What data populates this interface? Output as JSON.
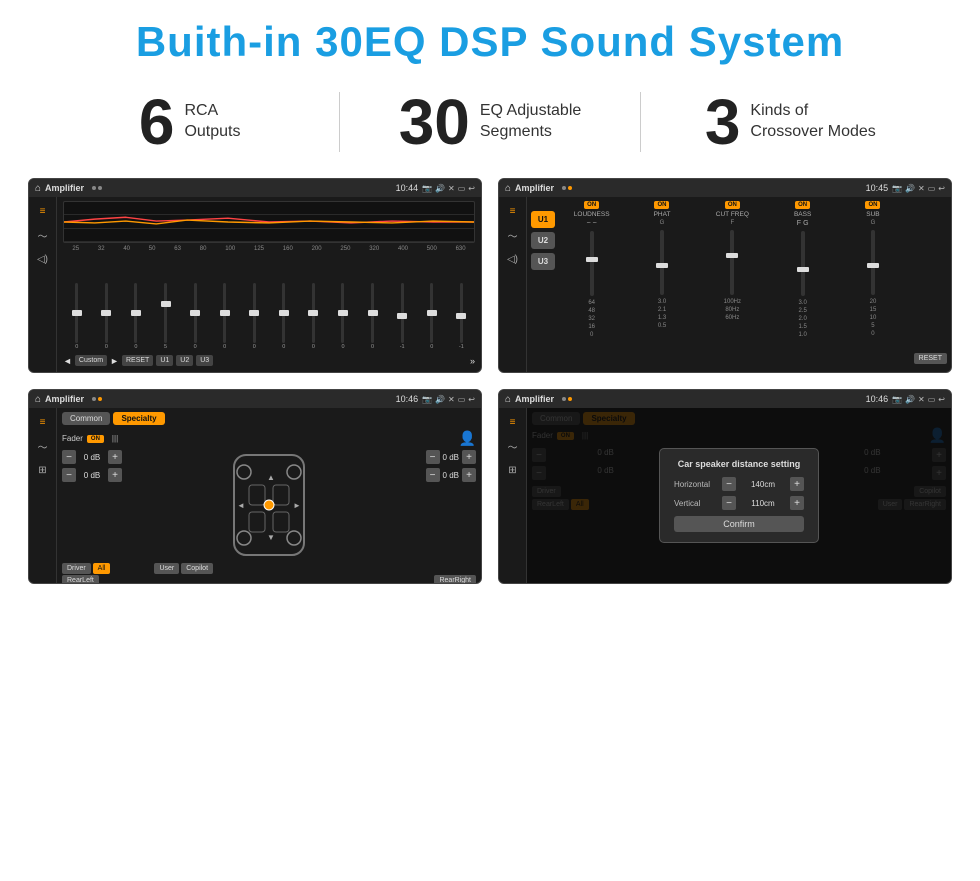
{
  "header": {
    "title": "Buith-in 30EQ DSP Sound System"
  },
  "stats": [
    {
      "number": "6",
      "label_line1": "RCA",
      "label_line2": "Outputs"
    },
    {
      "number": "30",
      "label_line1": "EQ Adjustable",
      "label_line2": "Segments"
    },
    {
      "number": "3",
      "label_line1": "Kinds of",
      "label_line2": "Crossover Modes"
    }
  ],
  "screens": {
    "screen1": {
      "topbar": {
        "title": "Amplifier",
        "time": "10:44"
      },
      "eq_freqs": [
        "25",
        "32",
        "40",
        "50",
        "63",
        "80",
        "100",
        "125",
        "160",
        "200",
        "250",
        "320",
        "400",
        "500",
        "630"
      ],
      "eq_vals": [
        "0",
        "0",
        "0",
        "5",
        "0",
        "0",
        "0",
        "0",
        "0",
        "0",
        "0",
        "-1",
        "0",
        "-1"
      ],
      "bottom_btns": [
        "Custom",
        "RESET",
        "U1",
        "U2",
        "U3"
      ]
    },
    "screen2": {
      "topbar": {
        "title": "Amplifier",
        "time": "10:45"
      },
      "presets": [
        "U1",
        "U2",
        "U3"
      ],
      "channels": [
        {
          "label": "LOUDNESS",
          "on": true
        },
        {
          "label": "PHAT",
          "on": true
        },
        {
          "label": "CUT FREQ",
          "on": true
        },
        {
          "label": "BASS",
          "on": true
        },
        {
          "label": "SUB",
          "on": true
        }
      ],
      "reset_label": "RESET"
    },
    "screen3": {
      "topbar": {
        "title": "Amplifier",
        "time": "10:46"
      },
      "tabs": [
        "Common",
        "Specialty"
      ],
      "fader_label": "Fader",
      "fader_on": "ON",
      "controls": [
        {
          "val": "0 dB"
        },
        {
          "val": "0 dB"
        },
        {
          "val": "0 dB"
        },
        {
          "val": "0 dB"
        }
      ],
      "bottom_btns": [
        "Driver",
        "RearLeft",
        "All",
        "User",
        "Copilot",
        "RearRight"
      ]
    },
    "screen4": {
      "topbar": {
        "title": "Amplifier",
        "time": "10:46"
      },
      "tabs": [
        "Common",
        "Specialty"
      ],
      "fader_on": "ON",
      "dialog": {
        "title": "Car speaker distance setting",
        "horizontal_label": "Horizontal",
        "horizontal_val": "140cm",
        "vertical_label": "Vertical",
        "vertical_val": "110cm",
        "confirm_label": "Confirm"
      },
      "bottom_btns": [
        "Driver",
        "RearLeft",
        "All",
        "User",
        "Copilot",
        "RearRight"
      ]
    }
  }
}
